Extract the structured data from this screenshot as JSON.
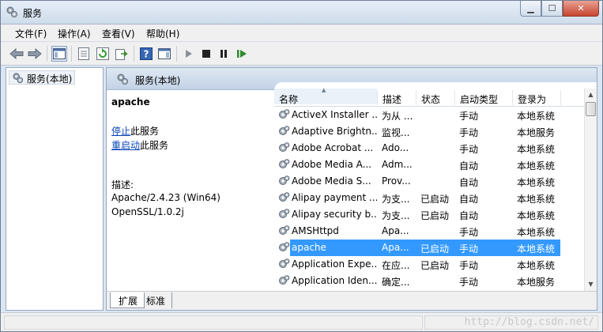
{
  "window": {
    "title": "服务"
  },
  "menu": [
    "文件(F)",
    "操作(A)",
    "查看(V)",
    "帮助(H)"
  ],
  "tree": {
    "root": "服务(本地)"
  },
  "pane": {
    "header": "服务(本地)",
    "service_name": "apache",
    "stop_link": "停止",
    "stop_suffix": "此服务",
    "restart_link": "重启动",
    "restart_suffix": "此服务",
    "desc_label": "描述:",
    "desc_lines": [
      "Apache/2.4.23 (Win64)",
      "OpenSSL/1.0.2j"
    ]
  },
  "columns": [
    "名称",
    "描述",
    "状态",
    "启动类型",
    "登录为"
  ],
  "services": [
    {
      "name": "ActiveX Installer ...",
      "desc": "为从 ...",
      "status": "",
      "startup": "手动",
      "logon": "本地系统"
    },
    {
      "name": "Adaptive Brightn...",
      "desc": "监视...",
      "status": "",
      "startup": "手动",
      "logon": "本地服务"
    },
    {
      "name": "Adobe Acrobat ...",
      "desc": "Ado...",
      "status": "",
      "startup": "手动",
      "logon": "本地系统"
    },
    {
      "name": "Adobe Media A...",
      "desc": "Adm...",
      "status": "",
      "startup": "自动",
      "logon": "本地系统"
    },
    {
      "name": "Adobe Media S...",
      "desc": "Prov...",
      "status": "",
      "startup": "自动",
      "logon": "本地系统"
    },
    {
      "name": "Alipay payment ...",
      "desc": "为支...",
      "status": "已启动",
      "startup": "自动",
      "logon": "本地系统"
    },
    {
      "name": "Alipay security b...",
      "desc": "为支...",
      "status": "已启动",
      "startup": "自动",
      "logon": "本地系统"
    },
    {
      "name": "AMSHttpd",
      "desc": "Apa...",
      "status": "",
      "startup": "手动",
      "logon": "本地系统"
    },
    {
      "name": "apache",
      "desc": "Apa...",
      "status": "已启动",
      "startup": "手动",
      "logon": "本地系统",
      "selected": true
    },
    {
      "name": "Application Expe...",
      "desc": "在应...",
      "status": "已启动",
      "startup": "手动",
      "logon": "本地系统"
    },
    {
      "name": "Application Iden...",
      "desc": "确定...",
      "status": "",
      "startup": "手动",
      "logon": "本地服务"
    }
  ],
  "tabs": [
    "扩展",
    "标准"
  ],
  "watermark": "http://blog.csdn.net/",
  "colors": {
    "selection": "#3399ff",
    "link": "#0b47b8",
    "titlebar": "#d9e6f3"
  }
}
